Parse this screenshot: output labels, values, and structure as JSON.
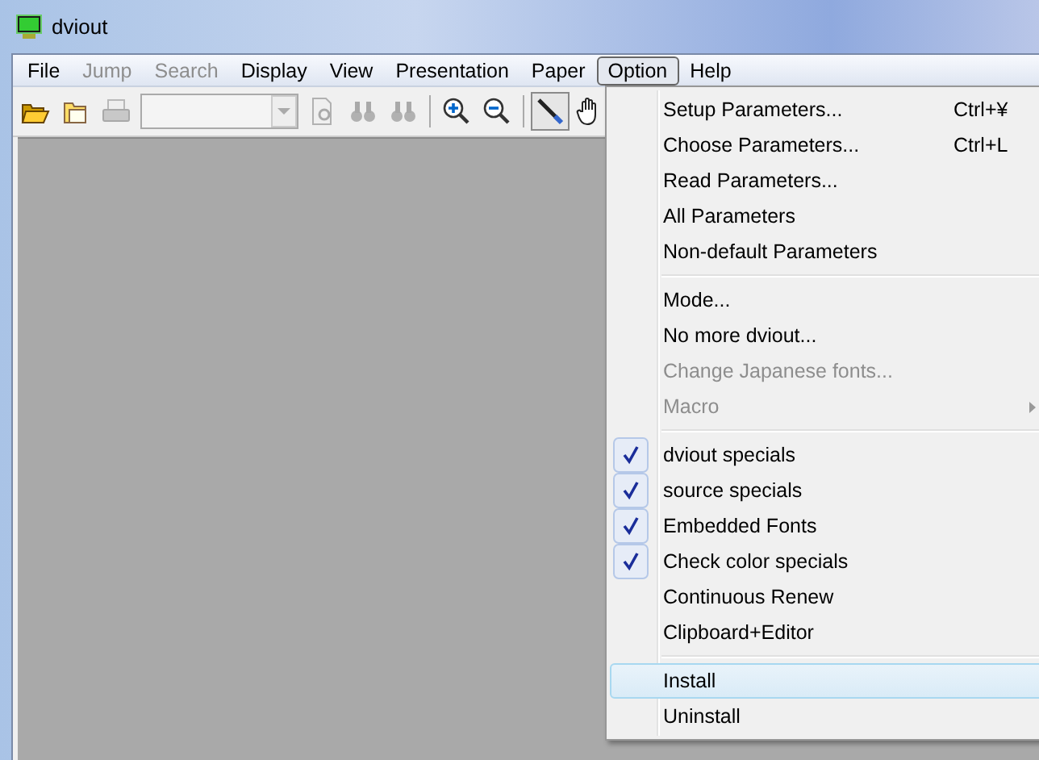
{
  "window": {
    "title": "dviout"
  },
  "menu_bar": [
    {
      "label": "File",
      "disabled": false,
      "selected": false
    },
    {
      "label": "Jump",
      "disabled": true,
      "selected": false
    },
    {
      "label": "Search",
      "disabled": true,
      "selected": false
    },
    {
      "label": "Display",
      "disabled": false,
      "selected": false
    },
    {
      "label": "View",
      "disabled": false,
      "selected": false
    },
    {
      "label": "Presentation",
      "disabled": false,
      "selected": false
    },
    {
      "label": "Paper",
      "disabled": false,
      "selected": false
    },
    {
      "label": "Option",
      "disabled": false,
      "selected": true
    },
    {
      "label": "Help",
      "disabled": false,
      "selected": false
    }
  ],
  "toolbar": [
    [
      {
        "kind": "open-folder",
        "disabled": false,
        "selected": false
      },
      {
        "kind": "folder",
        "disabled": false,
        "selected": false
      },
      {
        "kind": "printer",
        "disabled": true,
        "selected": false
      },
      {
        "kind": "page-combo",
        "disabled": true,
        "selected": false
      },
      {
        "kind": "page-search",
        "disabled": true,
        "selected": false
      },
      {
        "kind": "binoculars",
        "disabled": true,
        "selected": false
      },
      {
        "kind": "binoculars",
        "disabled": true,
        "selected": false
      }
    ],
    [
      {
        "kind": "zoom-in",
        "disabled": false,
        "selected": false
      },
      {
        "kind": "zoom-out",
        "disabled": false,
        "selected": false
      }
    ],
    [
      {
        "kind": "pointer",
        "disabled": false,
        "selected": true
      },
      {
        "kind": "hand",
        "disabled": false,
        "selected": false
      }
    ]
  ],
  "option_menu": {
    "groups": [
      [
        {
          "label": "Setup Parameters...",
          "shortcut": "Ctrl+¥",
          "disabled": false,
          "checked": false,
          "submenu": false,
          "selected": false
        },
        {
          "label": "Choose Parameters...",
          "shortcut": "Ctrl+L",
          "disabled": false,
          "checked": false,
          "submenu": false,
          "selected": false
        },
        {
          "label": "Read Parameters...",
          "disabled": false,
          "checked": false,
          "submenu": false,
          "selected": false
        },
        {
          "label": "All Parameters",
          "disabled": false,
          "checked": false,
          "submenu": false,
          "selected": false
        },
        {
          "label": "Non-default Parameters",
          "disabled": false,
          "checked": false,
          "submenu": false,
          "selected": false
        }
      ],
      [
        {
          "label": "Mode...",
          "disabled": false,
          "checked": false,
          "submenu": false,
          "selected": false
        },
        {
          "label": "No more dviout...",
          "disabled": false,
          "checked": false,
          "submenu": false,
          "selected": false
        },
        {
          "label": "Change Japanese fonts...",
          "disabled": true,
          "checked": false,
          "submenu": false,
          "selected": false
        },
        {
          "label": "Macro",
          "disabled": true,
          "checked": false,
          "submenu": true,
          "selected": false
        }
      ],
      [
        {
          "label": "dviout specials",
          "disabled": false,
          "checked": true,
          "submenu": false,
          "selected": false
        },
        {
          "label": "source specials",
          "disabled": false,
          "checked": true,
          "submenu": false,
          "selected": false
        },
        {
          "label": "Embedded Fonts",
          "disabled": false,
          "checked": true,
          "submenu": false,
          "selected": false
        },
        {
          "label": "Check color specials",
          "disabled": false,
          "checked": true,
          "submenu": false,
          "selected": false
        },
        {
          "label": "Continuous Renew",
          "disabled": false,
          "checked": false,
          "submenu": false,
          "selected": false
        },
        {
          "label": "Clipboard+Editor",
          "disabled": false,
          "checked": false,
          "submenu": false,
          "selected": false
        }
      ],
      [
        {
          "label": "Install",
          "disabled": false,
          "checked": false,
          "submenu": false,
          "selected": true
        },
        {
          "label": "Uninstall",
          "disabled": false,
          "checked": false,
          "submenu": false,
          "selected": false
        }
      ]
    ]
  }
}
